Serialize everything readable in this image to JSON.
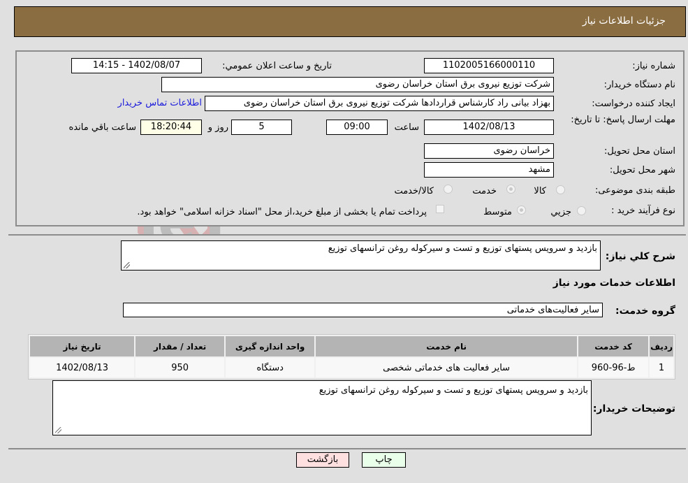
{
  "header": {
    "title": "جزئیات اطلاعات نیاز"
  },
  "form": {
    "need_number": {
      "label": "شماره نیاز:",
      "value": "1102005166000110"
    },
    "announce_datetime": {
      "label": "تاریخ و ساعت اعلان عمومي:",
      "value": "1402/08/07 - 14:15"
    },
    "buyer_org": {
      "label": "نام دستگاه خريدار:",
      "value": "شرکت توزیع نیروی برق استان خراسان رضوی"
    },
    "requester": {
      "label": "ايجاد کننده درخواست:",
      "value": "بهزاد بیانی راد کارشناس قراردادها شرکت توزیع نیروی برق استان خراسان رضوی",
      "contact_link": "اطلاعات تماس خریدار"
    },
    "deadline": {
      "label": "مهلت ارسال پاسخ: تا تاريخ:",
      "date": "1402/08/13",
      "time_label": "ساعت",
      "time": "09:00",
      "days": "5",
      "days_label": "روز و",
      "remaining": "18:20:44",
      "remaining_label": "ساعت باقي مانده"
    },
    "delivery_province": {
      "label": "استان محل تحويل:",
      "value": "خراسان رضوی"
    },
    "delivery_city": {
      "label": "شهر محل تحويل:",
      "value": "مشهد"
    },
    "category": {
      "label": "طبقه بندی موضوعی:",
      "options": [
        "کالا",
        "خدمت",
        "کالا/خدمت"
      ],
      "selected": "خدمت"
    },
    "purchase_process": {
      "label": "نوع فرآيند خريد :",
      "options": [
        "جزيي",
        "متوسط"
      ],
      "selected": "متوسط",
      "treasury_note": "پرداخت تمام یا بخشی از مبلغ خرید،از محل \"اسناد خزانه اسلامی\" خواهد بود.",
      "treasury_checked": false
    }
  },
  "details": {
    "general_desc": {
      "label": "شرح كلي نياز:",
      "value": "بازدید و سرویس پستهای توزیع و تست و سیرکوله روغن ترانسهای توزیع"
    },
    "section_title": "اطلاعات خدمات مورد نياز",
    "service_group": {
      "label": "گروه خدمت:",
      "value": "سایر فعالیت‌های خدماتی"
    },
    "table": {
      "headers": [
        "رديف",
        "کد خدمت",
        "نام خدمت",
        "واحد اندازه گیری",
        "تعداد / مقدار",
        "تاریخ نیاز"
      ],
      "rows": [
        [
          "1",
          "ط-96-960",
          "سایر فعالیت های خدماتی شخصی",
          "دستگاه",
          "950",
          "1402/08/13"
        ]
      ]
    },
    "buyer_notes": {
      "label": "توضيحات خريدار:",
      "value": "بازدید و سرویس پستهای توزیع و تست و سیرکوله روغن ترانسهای توزیع"
    }
  },
  "buttons": {
    "print": "چاپ",
    "back": "بازگشت"
  },
  "colors": {
    "header_bg": "#8b6d42",
    "print_bg": "#eaffea",
    "back_bg": "#ffe0e0",
    "link": "#1a1adc"
  }
}
